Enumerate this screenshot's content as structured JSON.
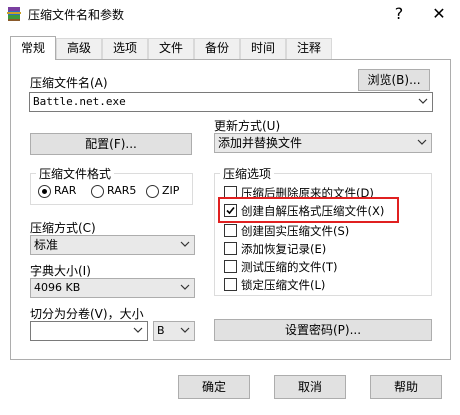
{
  "window": {
    "title": "压缩文件名和参数",
    "help_btn": "?",
    "close_btn": "✕"
  },
  "tabs": [
    "常规",
    "高级",
    "选项",
    "文件",
    "备份",
    "时间",
    "注释"
  ],
  "general": {
    "archive_name_label": "压缩文件名(A)",
    "browse_button": "浏览(B)...",
    "archive_name_value": "Battle.net.exe",
    "profiles_button": "配置(F)...",
    "update_mode_label": "更新方式(U)",
    "update_mode_value": "添加并替换文件",
    "format_group_title": "压缩文件格式",
    "formats": [
      {
        "label": "RAR",
        "selected": true
      },
      {
        "label": "RAR5",
        "selected": false
      },
      {
        "label": "ZIP",
        "selected": false
      }
    ],
    "method_label": "压缩方式(C)",
    "method_value": "标准",
    "dict_label": "字典大小(I)",
    "dict_value": "4096 KB",
    "split_label": "切分为分卷(V)，大小",
    "split_value": "",
    "split_unit": "B",
    "options_group_title": "压缩选项",
    "options": [
      {
        "label": "压缩后删除原来的文件(D)",
        "checked": false
      },
      {
        "label": "创建自解压格式压缩文件(X)",
        "checked": true
      },
      {
        "label": "创建固实压缩文件(S)",
        "checked": false
      },
      {
        "label": "添加恢复记录(E)",
        "checked": false
      },
      {
        "label": "测试压缩的文件(T)",
        "checked": false
      },
      {
        "label": "锁定压缩文件(L)",
        "checked": false
      }
    ],
    "password_button": "设置密码(P)..."
  },
  "footer": {
    "ok": "确定",
    "cancel": "取消",
    "help": "帮助"
  },
  "colors": {
    "highlight": "#e02020",
    "button_face": "#e1e1e1"
  }
}
